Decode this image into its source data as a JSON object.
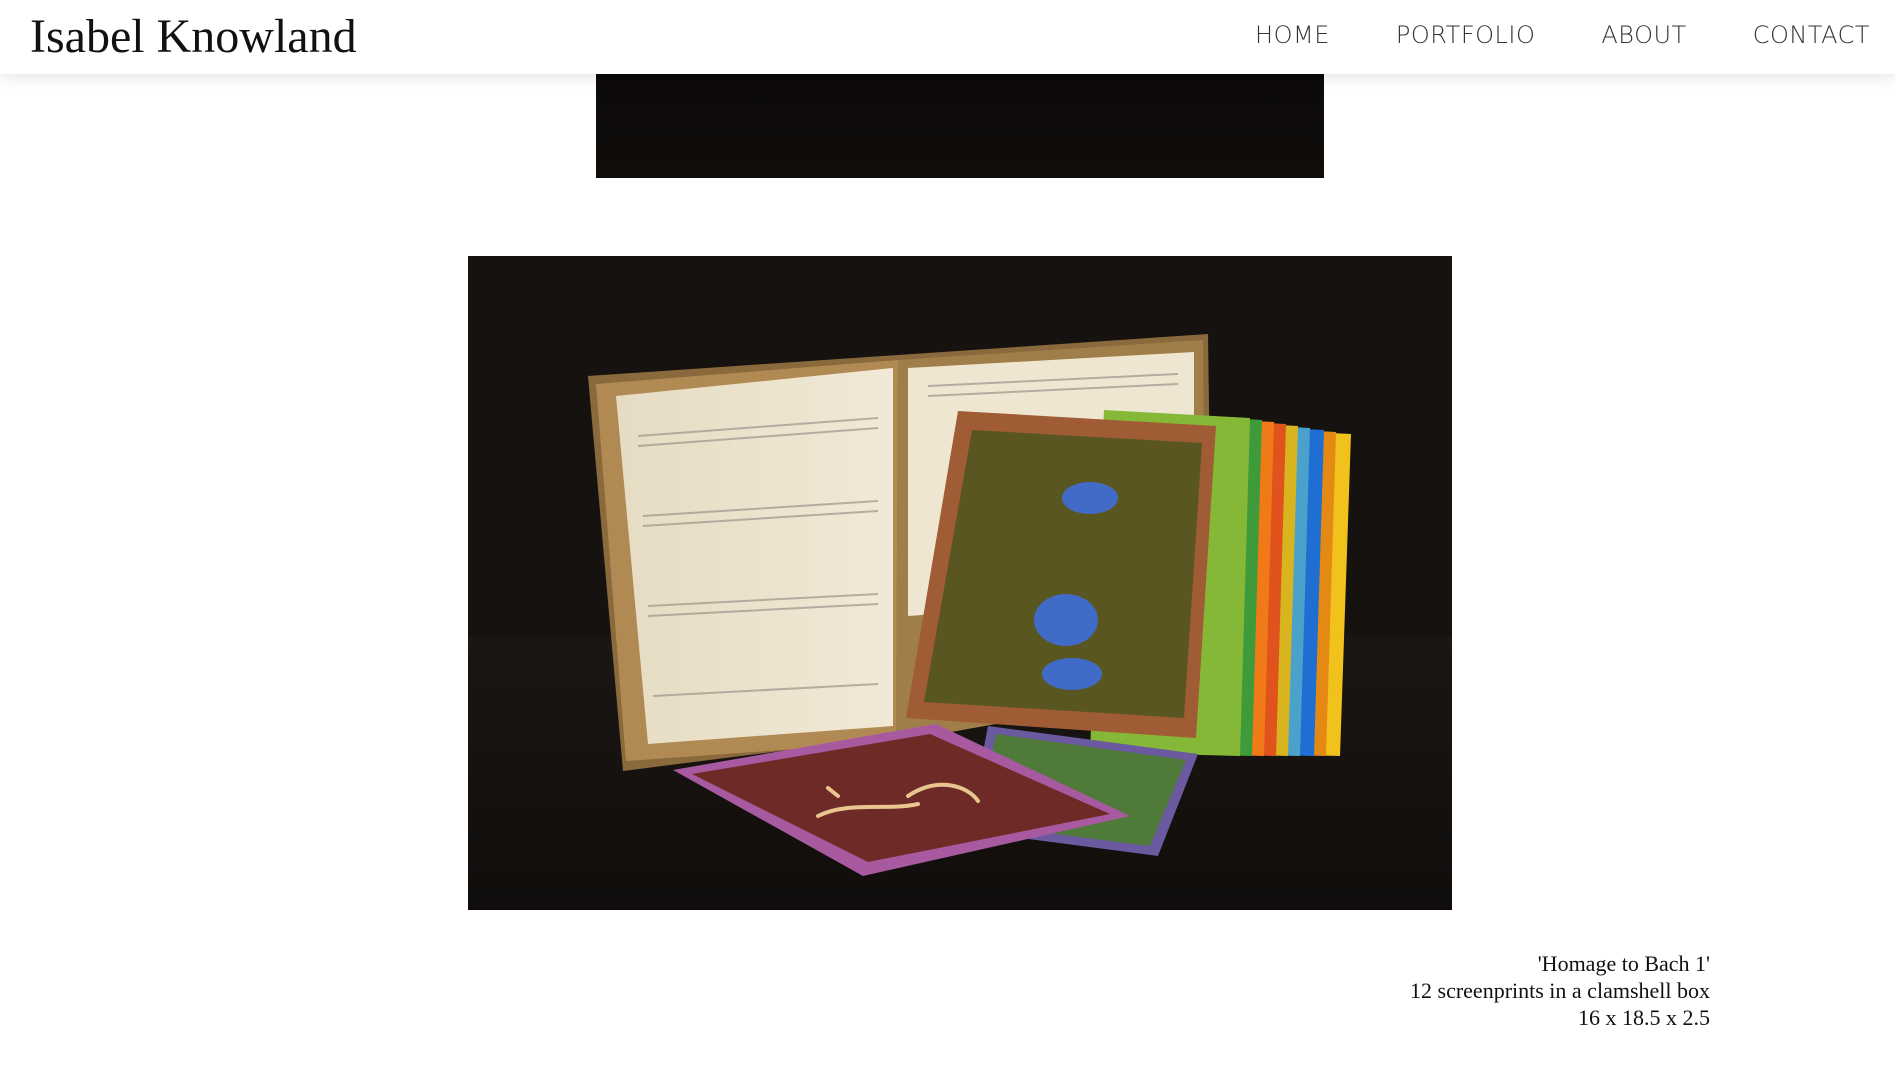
{
  "header": {
    "site_title": "Isabel Knowland",
    "nav": {
      "home": "HOME",
      "portfolio": "PORTFOLIO",
      "about": "ABOUT",
      "contact": "CONTACT"
    }
  },
  "artwork": {
    "caption": {
      "title": "'Homage to Bach 1'",
      "medium": "12 screenprints in a clamshell box",
      "dimensions": "16 x 18.5 x 2.5"
    }
  },
  "colors": {
    "background": "#ffffff",
    "text": "#111111",
    "nav_text": "#333333",
    "photo_background": "#14110f"
  }
}
